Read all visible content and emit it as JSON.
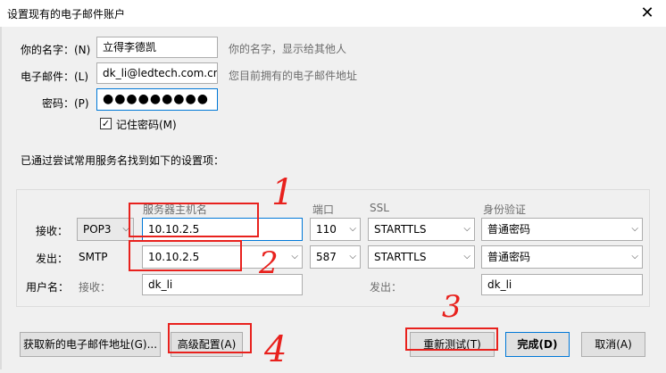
{
  "window": {
    "title": "设置现有的电子邮件账户"
  },
  "identity": {
    "name_label": "你的名字：(N)",
    "name_value": "立得李德凯",
    "name_hint": "你的名字，显示给其他人",
    "email_label": "电子邮件：(L)",
    "email_value": "dk_li@ledtech.com.cn",
    "email_hint": "您目前拥有的电子邮件地址",
    "password_label": "密码：(P)",
    "password_value": "●●●●●●●●●",
    "remember_label": "记住密码(M)",
    "remember_checked": "✓"
  },
  "found_text": "已通过尝试常用服务名找到如下的设置项：",
  "server": {
    "col_hostname": "服务器主机名",
    "col_port": "端口",
    "col_ssl": "SSL",
    "col_auth": "身份验证",
    "incoming": {
      "label": "接收：",
      "protocol": "POP3",
      "hostname": "10.10.2.5",
      "port": "110",
      "ssl": "STARTTLS",
      "auth": "普通密码"
    },
    "outgoing": {
      "label": "发出：",
      "protocol": "SMTP",
      "hostname": "10.10.2.5",
      "port": "587",
      "ssl": "STARTTLS",
      "auth": "普通密码"
    },
    "username": {
      "label": "用户名：",
      "incoming_label": "接收：",
      "incoming_value": "dk_li",
      "outgoing_label": "发出：",
      "outgoing_value": "dk_li"
    }
  },
  "buttons": {
    "new_account": "获取新的电子邮件地址(G)...",
    "advanced": "高级配置(A)",
    "retest": "重新测试(T)",
    "done": "完成(D)",
    "cancel": "取消(A)"
  },
  "annotations": [
    "1",
    "2",
    "3",
    "4"
  ],
  "colors": {
    "annotation": "#e8211d",
    "focus_border": "#0078d7"
  },
  "icons": {
    "close": "✕",
    "dropdown": "⌵"
  }
}
